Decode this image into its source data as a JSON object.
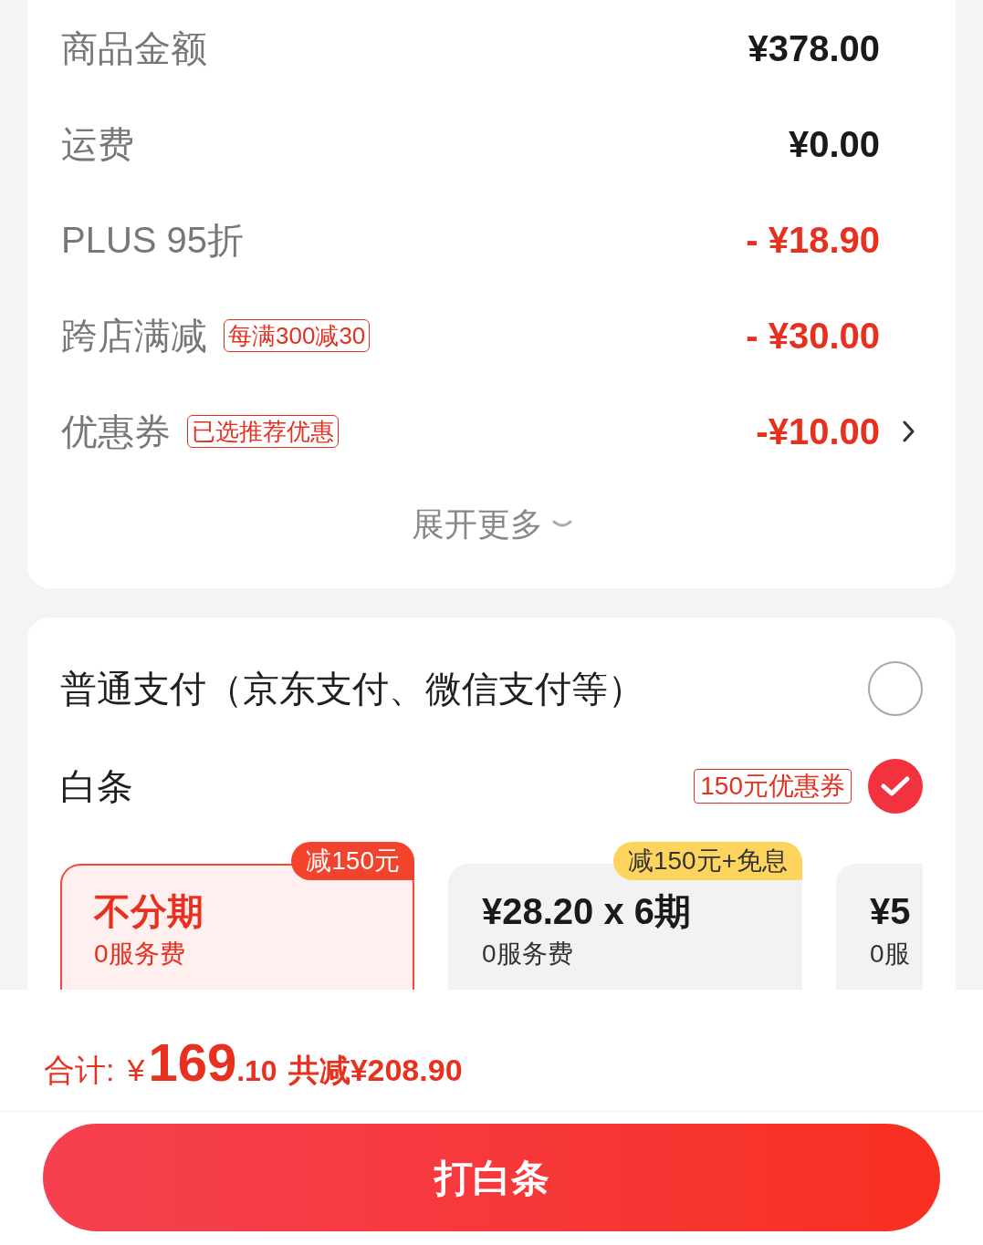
{
  "summary": {
    "rows": [
      {
        "label": "商品金额",
        "amount": "¥378.00",
        "kind": "charge",
        "arrow": false
      },
      {
        "label": "运费",
        "amount": "¥0.00",
        "kind": "charge",
        "arrow": false
      },
      {
        "label": "PLUS 95折",
        "amount": "- ¥18.90",
        "kind": "discount",
        "arrow": false
      },
      {
        "label": "跨店满减",
        "tag": "每满300减30",
        "amount": "- ¥30.00",
        "kind": "discount",
        "arrow": false
      },
      {
        "label": "优惠券",
        "tag": "已选推荐优惠",
        "amount": "-¥10.00",
        "kind": "discount",
        "arrow": true
      }
    ],
    "expand": {
      "label": "展开更多"
    }
  },
  "payment": {
    "options": [
      {
        "label": "普通支付（京东支付、微信支付等）",
        "selected": false
      },
      {
        "label": "白条",
        "tag": "150元优惠券",
        "selected": true
      }
    ],
    "installments": [
      {
        "title": "不分期",
        "subtitle": "0服务费",
        "badge": {
          "text": "减150元",
          "color": "#f4432c"
        },
        "selected": true
      },
      {
        "title": "¥28.20 x 6期",
        "subtitle": "0服务费",
        "badge": {
          "text": "减150元+免息",
          "color": "#fdd55e"
        },
        "selected": false
      },
      {
        "title": "¥5",
        "subtitle": "0服",
        "selected": false
      }
    ]
  },
  "total": {
    "label": "合计:",
    "currency": "¥",
    "integer": "169",
    "decimal": ".10",
    "saved": "共减¥208.90"
  },
  "submit": {
    "label": "打白条"
  }
}
